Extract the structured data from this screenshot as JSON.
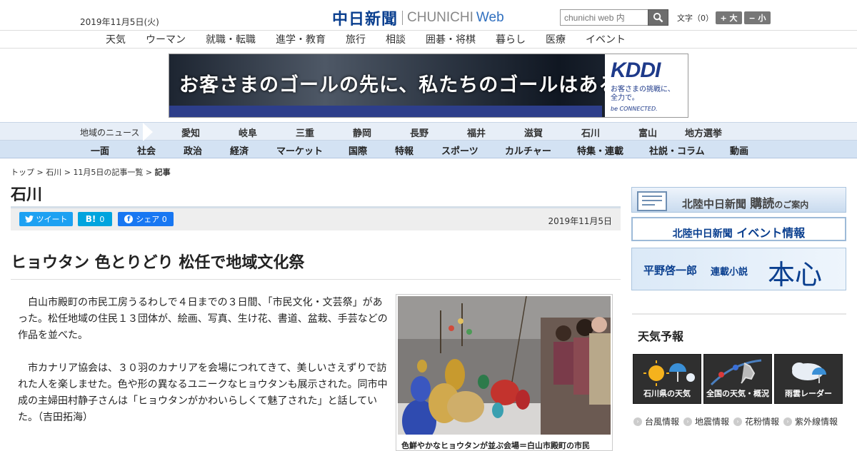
{
  "header": {
    "date": "2019年11月5日(火)",
    "logo_jp": "中日新聞",
    "logo_en": "CHUNICHI",
    "logo_web": "Web",
    "search_placeholder": "chunichi web 内",
    "fontsize_label": "文字（0）",
    "fontsize_up": "+ 大",
    "fontsize_down": "− 小"
  },
  "subnav": [
    "天気",
    "ウーマン",
    "就職・転職",
    "進学・教育",
    "旅行",
    "相談",
    "囲碁・将棋",
    "暮らし",
    "医療",
    "イベント"
  ],
  "ad": {
    "copy": "お客さまのゴールの先に、私たちのゴールはある。",
    "brand": "KDDI",
    "tagline_1": "お客さまの挑戦に、",
    "tagline_2": "全力で。",
    "be": "be CONNECTED."
  },
  "region_nav": {
    "label": "地域のニュース",
    "items": [
      "愛知",
      "岐阜",
      "三重",
      "静岡",
      "長野",
      "福井",
      "滋賀",
      "石川",
      "富山",
      "地方選挙"
    ]
  },
  "category_nav": [
    "一面",
    "社会",
    "政治",
    "経済",
    "マーケット",
    "国際",
    "特報",
    "スポーツ",
    "カルチャー",
    "特集・連載",
    "社説・コラム",
    "動画"
  ],
  "breadcrumb": {
    "top": "トップ",
    "sep": " > ",
    "region": "石川",
    "list": "11月5日の記事一覧",
    "current": "記事"
  },
  "section_title": "石川",
  "share": {
    "tweet": "ツイート",
    "hatena": "0",
    "facebook": "シェア 0",
    "date": "2019年11月5日"
  },
  "article": {
    "headline": "ヒョウタン 色とりどり 松任で地域文化祭",
    "paragraphs": [
      "白山市殿町の市民工房うるわしで４日までの３日間、「市民文化・文芸祭」があった。松任地域の住民１３団体が、絵画、写真、生け花、書道、盆栽、手芸などの作品を並べた。",
      "市カナリア協会は、３０羽のカナリアを会場につれてきて、美しいさえずりで訪れた人を楽しませた。色や形の異なるユニークなヒョウタンも展示された。同市中成の主婦田村静子さんは「ヒョウタンがかわいらしくて魅了された」と話していた。（吉田拓海）"
    ],
    "caption": "色鮮やかなヒョウタンが並ぶ会場＝白山市殿町の市民"
  },
  "sidebar": {
    "subscribe_1": "北陸中日新聞",
    "subscribe_2": "購読",
    "subscribe_3": "のご案内",
    "event_1": "北陸中日新聞",
    "event_2": "イベント情報",
    "novel_author": "平野啓一郎",
    "novel_label": "連載小説",
    "novel_title": "本心",
    "weather_title": "天気予報",
    "weather_boxes": [
      "石川県の天気",
      "全国の天気・概況",
      "雨雲レーダー"
    ],
    "weather_links": [
      "台風情報",
      "地震情報",
      "花粉情報",
      "紫外線情報"
    ]
  }
}
